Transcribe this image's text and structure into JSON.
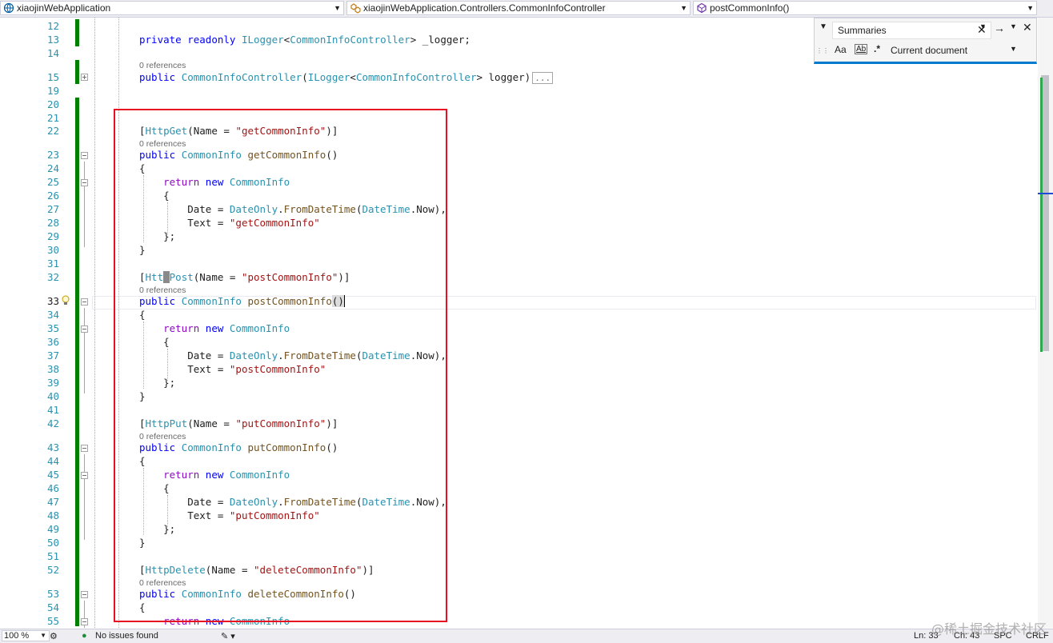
{
  "nav": {
    "project": "xiaojinWebApplication",
    "class": "xiaojinWebApplication.Controllers.CommonInfoController",
    "member": "postCommonInfo()"
  },
  "find": {
    "query": "Summaries",
    "scope": "Current document",
    "match_case": "Aa",
    "whole_word": "Ab"
  },
  "editor": {
    "lines": [
      {
        "n": "12",
        "text": ""
      },
      {
        "n": "13",
        "text": "private readonly ILogger<CommonInfoController> _logger;"
      },
      {
        "n": "14",
        "text": ""
      },
      {
        "n": "15",
        "lens": "0 references",
        "text": "public CommonInfoController(ILogger<CommonInfoController> logger)"
      },
      {
        "n": "19",
        "text": ""
      },
      {
        "n": "20",
        "text": ""
      },
      {
        "n": "21",
        "text": ""
      },
      {
        "n": "22",
        "text": "[HttpGet(Name = \"getCommonInfo\")]"
      },
      {
        "n": "23",
        "lens": "0 references",
        "text": "public CommonInfo getCommonInfo()"
      },
      {
        "n": "24",
        "text": "{"
      },
      {
        "n": "25",
        "text": "return new CommonInfo"
      },
      {
        "n": "26",
        "text": "{"
      },
      {
        "n": "27",
        "text": "Date = DateOnly.FromDateTime(DateTime.Now),"
      },
      {
        "n": "28",
        "text": "Text = \"getCommonInfo\""
      },
      {
        "n": "29",
        "text": "};"
      },
      {
        "n": "30",
        "text": "}"
      },
      {
        "n": "31",
        "text": ""
      },
      {
        "n": "32",
        "text": "[HttpPost(Name = \"postCommonInfo\")]"
      },
      {
        "n": "33",
        "lens": "0 references",
        "text": "public CommonInfo postCommonInfo()"
      },
      {
        "n": "34",
        "text": "{"
      },
      {
        "n": "35",
        "text": "return new CommonInfo"
      },
      {
        "n": "36",
        "text": "{"
      },
      {
        "n": "37",
        "text": "Date = DateOnly.FromDateTime(DateTime.Now),"
      },
      {
        "n": "38",
        "text": "Text = \"postCommonInfo\""
      },
      {
        "n": "39",
        "text": "};"
      },
      {
        "n": "40",
        "text": "}"
      },
      {
        "n": "41",
        "text": ""
      },
      {
        "n": "42",
        "text": "[HttpPut(Name = \"putCommonInfo\")]"
      },
      {
        "n": "43",
        "lens": "0 references",
        "text": "public CommonInfo putCommonInfo()"
      },
      {
        "n": "44",
        "text": "{"
      },
      {
        "n": "45",
        "text": "return new CommonInfo"
      },
      {
        "n": "46",
        "text": "{"
      },
      {
        "n": "47",
        "text": "Date = DateOnly.FromDateTime(DateTime.Now),"
      },
      {
        "n": "48",
        "text": "Text = \"putCommonInfo\""
      },
      {
        "n": "49",
        "text": "};"
      },
      {
        "n": "50",
        "text": "}"
      },
      {
        "n": "51",
        "text": ""
      },
      {
        "n": "52",
        "text": "[HttpDelete(Name = \"deleteCommonInfo\")]"
      },
      {
        "n": "53",
        "lens": "0 references",
        "text": "public CommonInfo deleteCommonInfo()"
      },
      {
        "n": "54",
        "text": "{"
      },
      {
        "n": "55",
        "text": "return new CommonInfo"
      }
    ],
    "collapsed_marker": "..."
  },
  "status": {
    "zoom": "100 %",
    "issues": "No issues found",
    "line": "Ln: 33",
    "col": "Ch: 43",
    "whitespace": "SPC",
    "eol": "CRLF"
  },
  "watermark": "@稀土掘金技术社区",
  "colors": {
    "accent": "#007acc",
    "change_bar": "#008000",
    "highlight_box": "#e81123"
  }
}
